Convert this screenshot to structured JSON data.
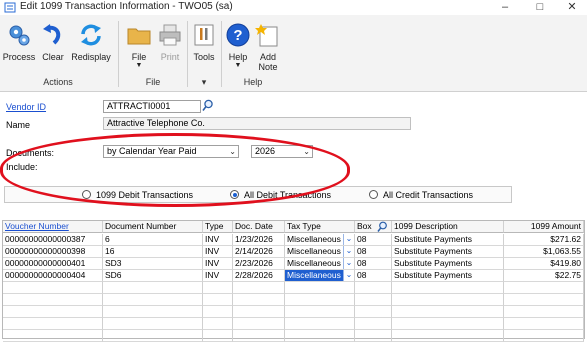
{
  "window": {
    "title": "Edit 1099 Transaction Information  -  TWO05 (sa)",
    "controls": [
      "–",
      "□",
      "✕"
    ]
  },
  "ribbon": {
    "actions_group": "Actions",
    "file_group": "File",
    "tools_group": "▾",
    "help_group": "Help",
    "buttons": {
      "process": "Process",
      "clear": "Clear",
      "redisplay": "Redisplay",
      "file": "File",
      "print": "Print",
      "tools": "Tools",
      "help": "Help",
      "add_note": "Add",
      "add_note2": "Note",
      "dropdown": "▼"
    }
  },
  "form": {
    "vendor_id_label": "Vendor ID",
    "vendor_id_value": "ATTRACTI0001",
    "name_label": "Name",
    "name_value": "Attractive Telephone Co.",
    "documents_label": "Documents:",
    "documents_value": "by Calendar Year Paid",
    "year_value": "2026",
    "include_label": "Include:",
    "radio_debit": "1099 Debit Transactions",
    "radio_all_debit": "All Debit Transactions",
    "radio_all_credit": "All Credit Transactions",
    "selected_radio": "All Debit Transactions"
  },
  "grid": {
    "headers": {
      "voucher": "Voucher Number",
      "document": "Document Number",
      "type": "Type",
      "date": "Doc. Date",
      "tax": "Tax Type",
      "box": "Box",
      "desc": "1099 Description",
      "amount": "1099 Amount"
    },
    "rows": [
      {
        "voucher": "00000000000000387",
        "document": "6",
        "type": "INV",
        "date": "1/23/2026",
        "tax": "Miscellaneous",
        "box": "08",
        "desc": "Substitute Payments",
        "amount": "$271.62"
      },
      {
        "voucher": "00000000000000398",
        "document": "16",
        "type": "INV",
        "date": "2/14/2026",
        "tax": "Miscellaneous",
        "box": "08",
        "desc": "Substitute Payments",
        "amount": "$1,063.55"
      },
      {
        "voucher": "00000000000000401",
        "document": "SD3",
        "type": "INV",
        "date": "2/23/2026",
        "tax": "Miscellaneous",
        "box": "08",
        "desc": "Substitute Payments",
        "amount": "$419.80"
      },
      {
        "voucher": "00000000000000404",
        "document": "SD6",
        "type": "INV",
        "date": "2/28/2026",
        "tax": "Miscellaneous",
        "box": "08",
        "desc": "Substitute Payments",
        "amount": "$22.75"
      }
    ],
    "selected_row_index": 3
  },
  "colors": {
    "accent": "#1f5fd0",
    "highlight_ring": "#e0101d"
  }
}
